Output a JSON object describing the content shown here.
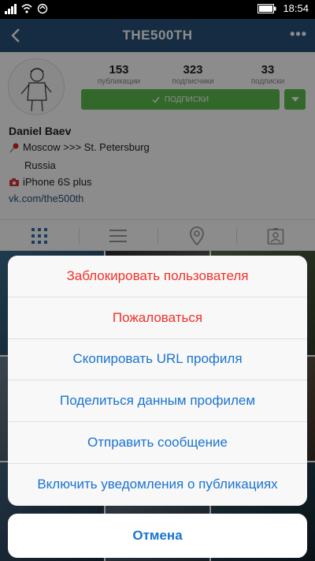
{
  "status_bar": {
    "time": "18:54"
  },
  "nav": {
    "title": "THE500TH"
  },
  "profile": {
    "stats": [
      {
        "value": "153",
        "label": "публикации"
      },
      {
        "value": "323",
        "label": "подписчики"
      },
      {
        "value": "33",
        "label": "подписки"
      }
    ],
    "follow_label": "ПОДПИСКИ",
    "name": "Daniel Baev",
    "bio_line1": "Moscow >>> St. Petersburg",
    "bio_line2": "Russia",
    "bio_line3": "iPhone 6S plus",
    "link": "vk.com/the500th"
  },
  "tabs": [
    "grid-icon",
    "list-icon",
    "location-pin-icon",
    "tagged-user-icon"
  ],
  "action_sheet": {
    "items": [
      {
        "label": "Заблокировать пользователя",
        "color": "#f2302a"
      },
      {
        "label": "Пожаловаться",
        "color": "#f2302a"
      },
      {
        "label": "Скопировать URL профиля",
        "color": "#1a73d1"
      },
      {
        "label": "Поделиться данным профилем",
        "color": "#1a73d1"
      },
      {
        "label": "Отправить сообщение",
        "color": "#1a73d1"
      },
      {
        "label": "Включить уведомления о публикациях",
        "color": "#1a73d1"
      }
    ],
    "cancel_label": "Отмена"
  },
  "colors": {
    "accent": "#27517b",
    "follow_green": "#5bbd4b",
    "destructive": "#f2302a",
    "action_blue": "#1a73d1"
  }
}
